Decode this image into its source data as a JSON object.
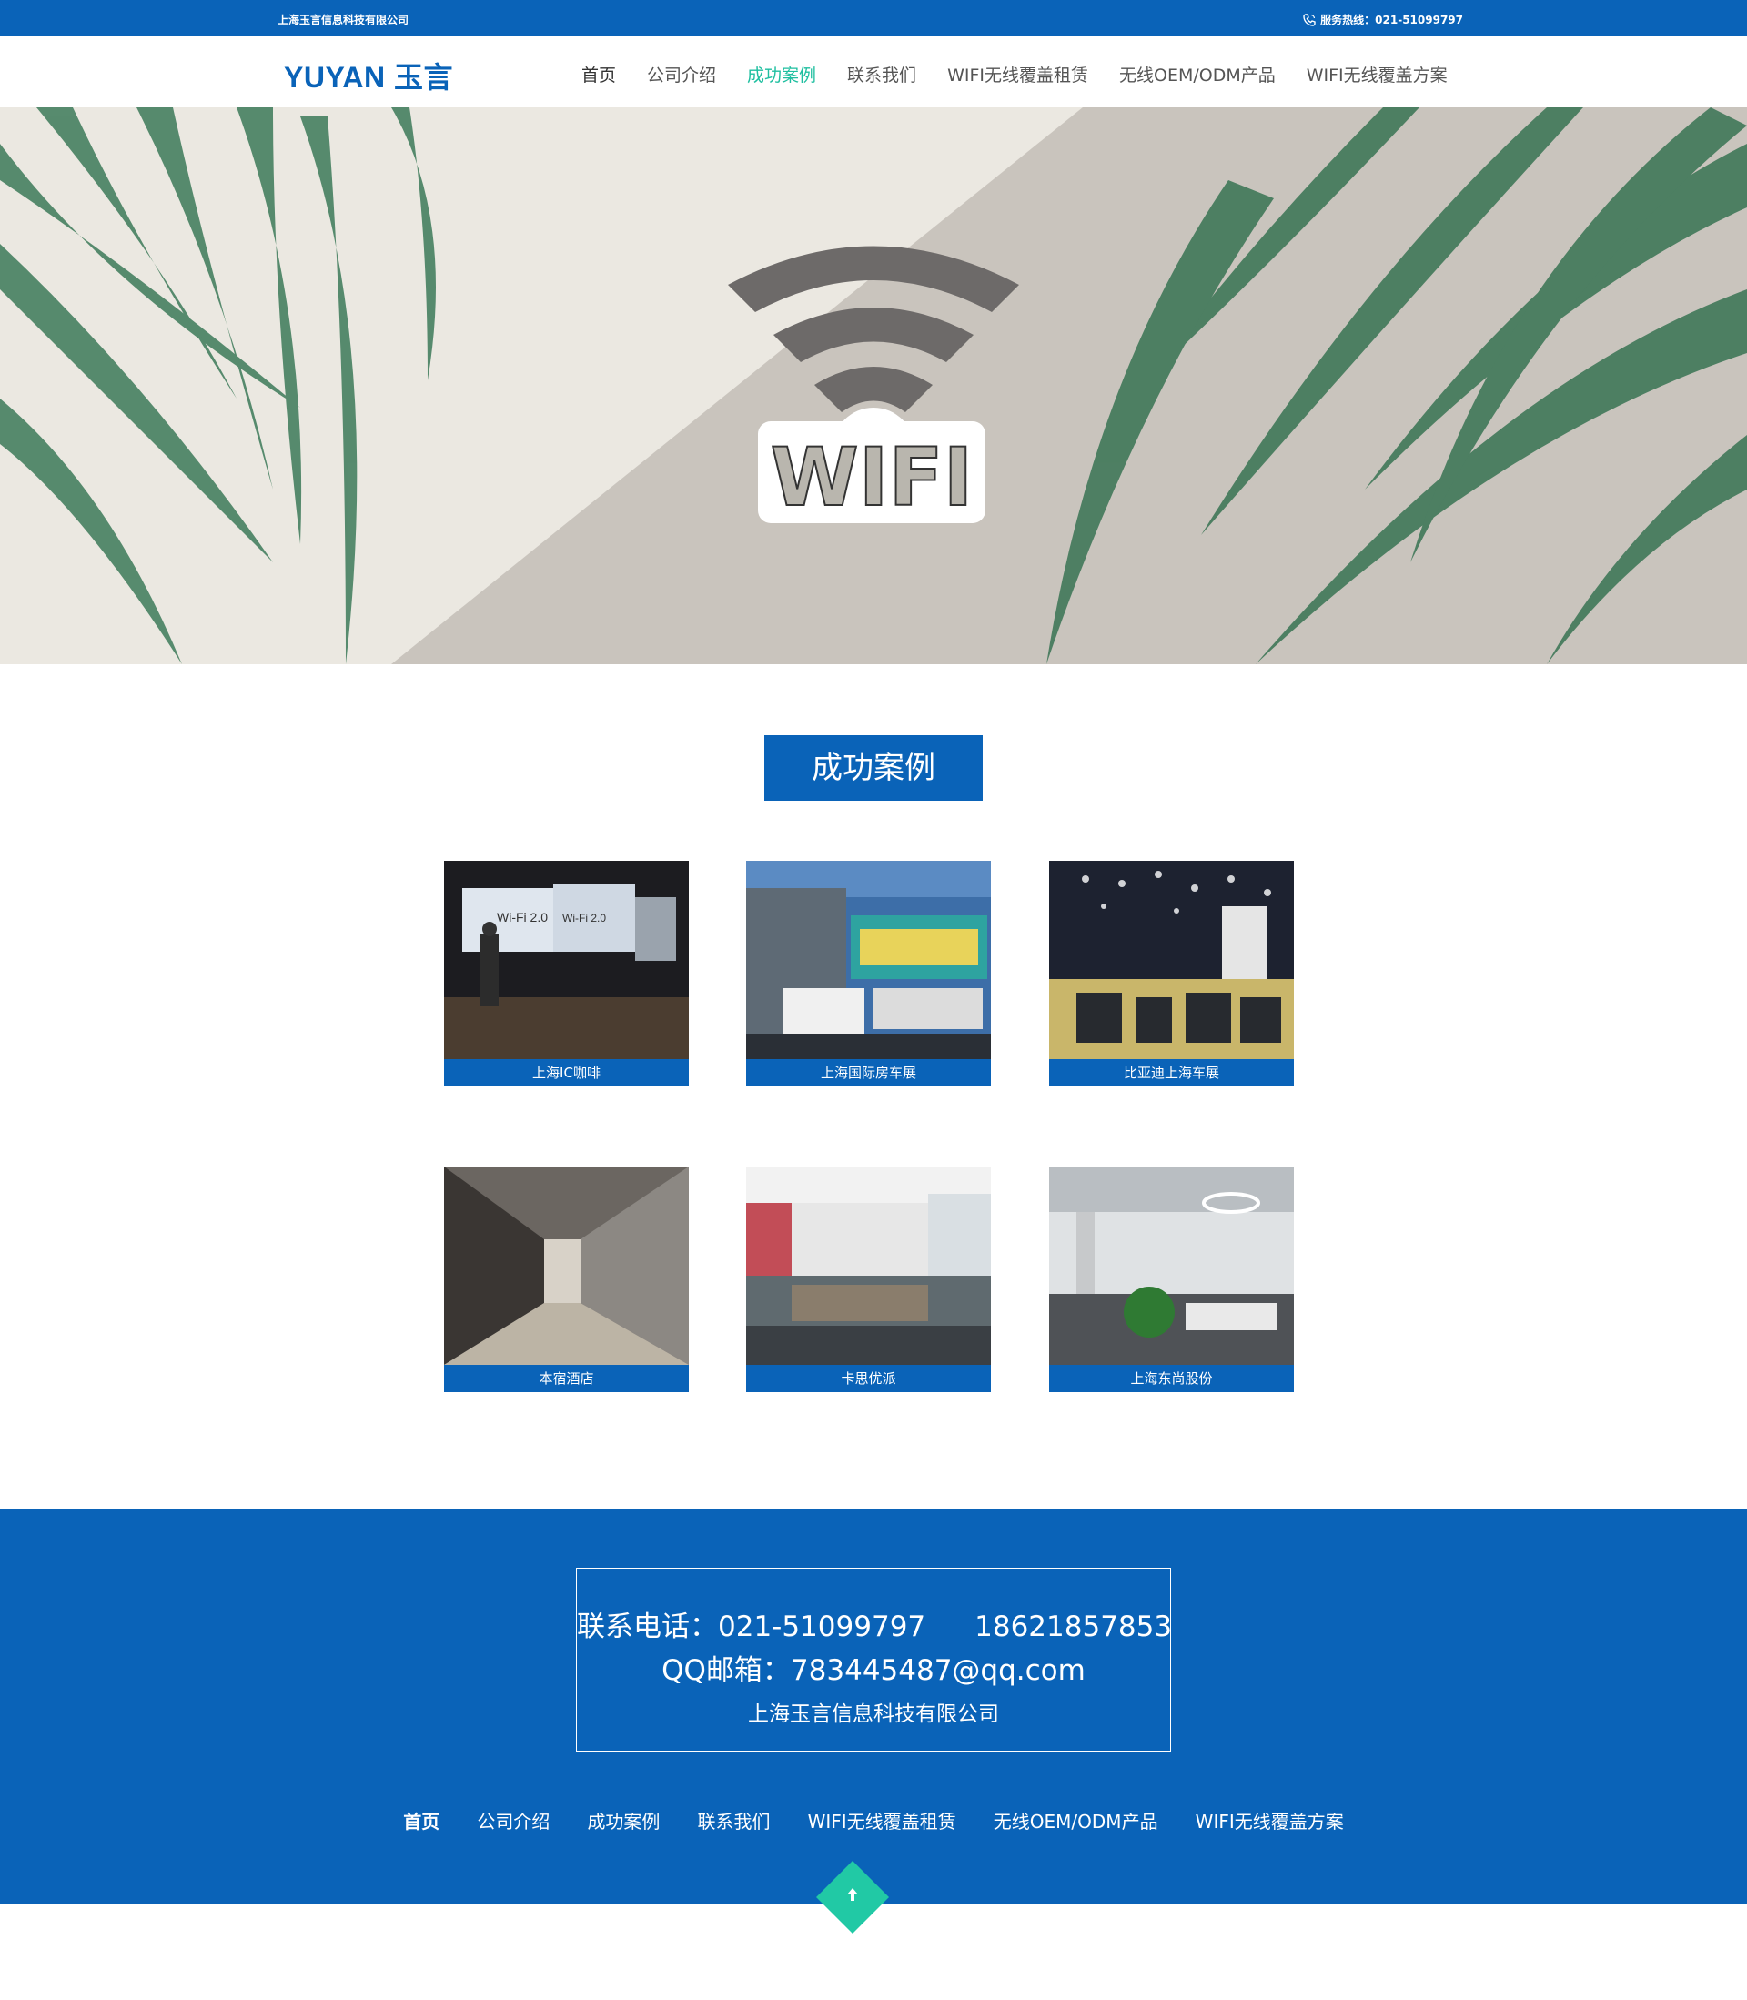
{
  "topbar": {
    "company": "上海玉言信息科技有限公司",
    "hotline_label": "服务热线：021-51099797",
    "phone_icon": "phone-icon"
  },
  "header": {
    "logo": "YUYAN 玉言",
    "nav": [
      {
        "label": "首页"
      },
      {
        "label": "公司介绍"
      },
      {
        "label": "成功案例",
        "active": true
      },
      {
        "label": "联系我们"
      },
      {
        "label": "WIFI无线覆盖租赁"
      },
      {
        "label": "无线OEM/ODM产品"
      },
      {
        "label": "WIFI无线覆盖方案"
      }
    ]
  },
  "banner": {
    "wifi_text": "WIFI"
  },
  "section": {
    "title": "成功案例"
  },
  "cases": [
    {
      "caption": "上海IC咖啡"
    },
    {
      "caption": "上海国际房车展"
    },
    {
      "caption": "比亚迪上海车展"
    },
    {
      "caption": "本宿酒店"
    },
    {
      "caption": "卡思优派"
    },
    {
      "caption": "上海东尚股份"
    }
  ],
  "footer": {
    "phone_label": "联系电话：021-51099797",
    "mobile": "18621857853",
    "qq_email": "QQ邮箱：783445487@qq.com",
    "company": "上海玉言信息科技有限公司",
    "nav": [
      {
        "label": "首页"
      },
      {
        "label": "公司介绍"
      },
      {
        "label": "成功案例"
      },
      {
        "label": "联系我们"
      },
      {
        "label": "WIFI无线覆盖租赁"
      },
      {
        "label": "无线OEM/ODM产品"
      },
      {
        "label": "WIFI无线覆盖方案"
      }
    ],
    "back_to_top_icon": "arrow-up-icon"
  },
  "colors": {
    "brand_blue": "#0a63b8",
    "accent_teal": "#1fbfa0"
  }
}
